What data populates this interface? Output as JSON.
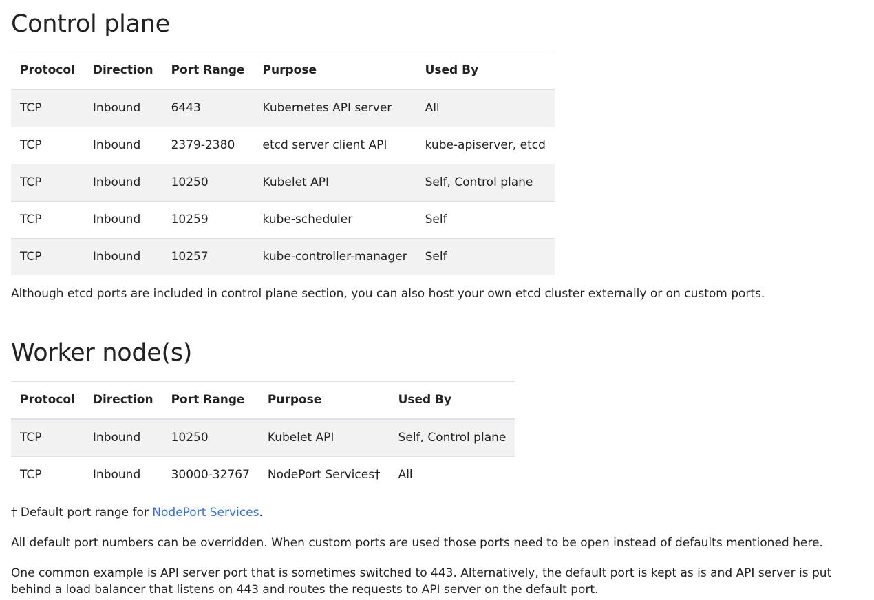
{
  "control_plane": {
    "heading": "Control plane",
    "columns": [
      "Protocol",
      "Direction",
      "Port Range",
      "Purpose",
      "Used By"
    ],
    "rows": [
      [
        "TCP",
        "Inbound",
        "6443",
        "Kubernetes API server",
        "All"
      ],
      [
        "TCP",
        "Inbound",
        "2379-2380",
        "etcd server client API",
        "kube-apiserver, etcd"
      ],
      [
        "TCP",
        "Inbound",
        "10250",
        "Kubelet API",
        "Self, Control plane"
      ],
      [
        "TCP",
        "Inbound",
        "10259",
        "kube-scheduler",
        "Self"
      ],
      [
        "TCP",
        "Inbound",
        "10257",
        "kube-controller-manager",
        "Self"
      ]
    ],
    "note": "Although etcd ports are included in control plane section, you can also host your own etcd cluster externally or on custom ports."
  },
  "worker_nodes": {
    "heading": "Worker node(s)",
    "columns": [
      "Protocol",
      "Direction",
      "Port Range",
      "Purpose",
      "Used By"
    ],
    "rows": [
      [
        "TCP",
        "Inbound",
        "10250",
        "Kubelet API",
        "Self, Control plane"
      ],
      [
        "TCP",
        "Inbound",
        "30000-32767",
        "NodePort Services†",
        "All"
      ]
    ],
    "footnote_prefix": "† Default port range for ",
    "footnote_link": "NodePort Services",
    "footnote_suffix": ".",
    "override_note": "All default port numbers can be overridden. When custom ports are used those ports need to be open instead of defaults mentioned here.",
    "example_note": "One common example is API server port that is sometimes switched to 443. Alternatively, the default port is kept as is and API server is put behind a load balancer that listens on 443 and routes the requests to API server on the default port."
  },
  "colors": {
    "link": "#3371e3",
    "stripe": "#f2f2f2",
    "border": "#dee2e6"
  }
}
